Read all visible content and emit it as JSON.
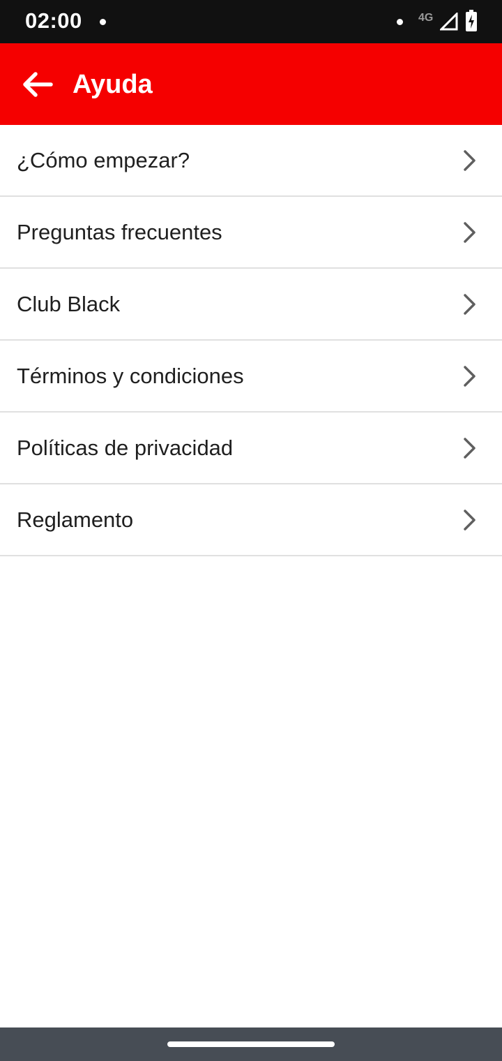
{
  "status_bar": {
    "time": "02:00",
    "network": "4G"
  },
  "app_bar": {
    "title": "Ayuda",
    "background_color": "#f50000"
  },
  "menu": {
    "items": [
      {
        "label": "¿Cómo empezar?",
        "icon": "chevron-right-icon"
      },
      {
        "label": "Preguntas frecuentes",
        "icon": "chevron-right-icon"
      },
      {
        "label": "Club Black",
        "icon": "chevron-right-icon"
      },
      {
        "label": "Términos y condiciones",
        "icon": "chevron-right-icon"
      },
      {
        "label": "Políticas de privacidad",
        "icon": "chevron-right-icon"
      },
      {
        "label": "Reglamento",
        "icon": "chevron-right-icon"
      }
    ]
  }
}
